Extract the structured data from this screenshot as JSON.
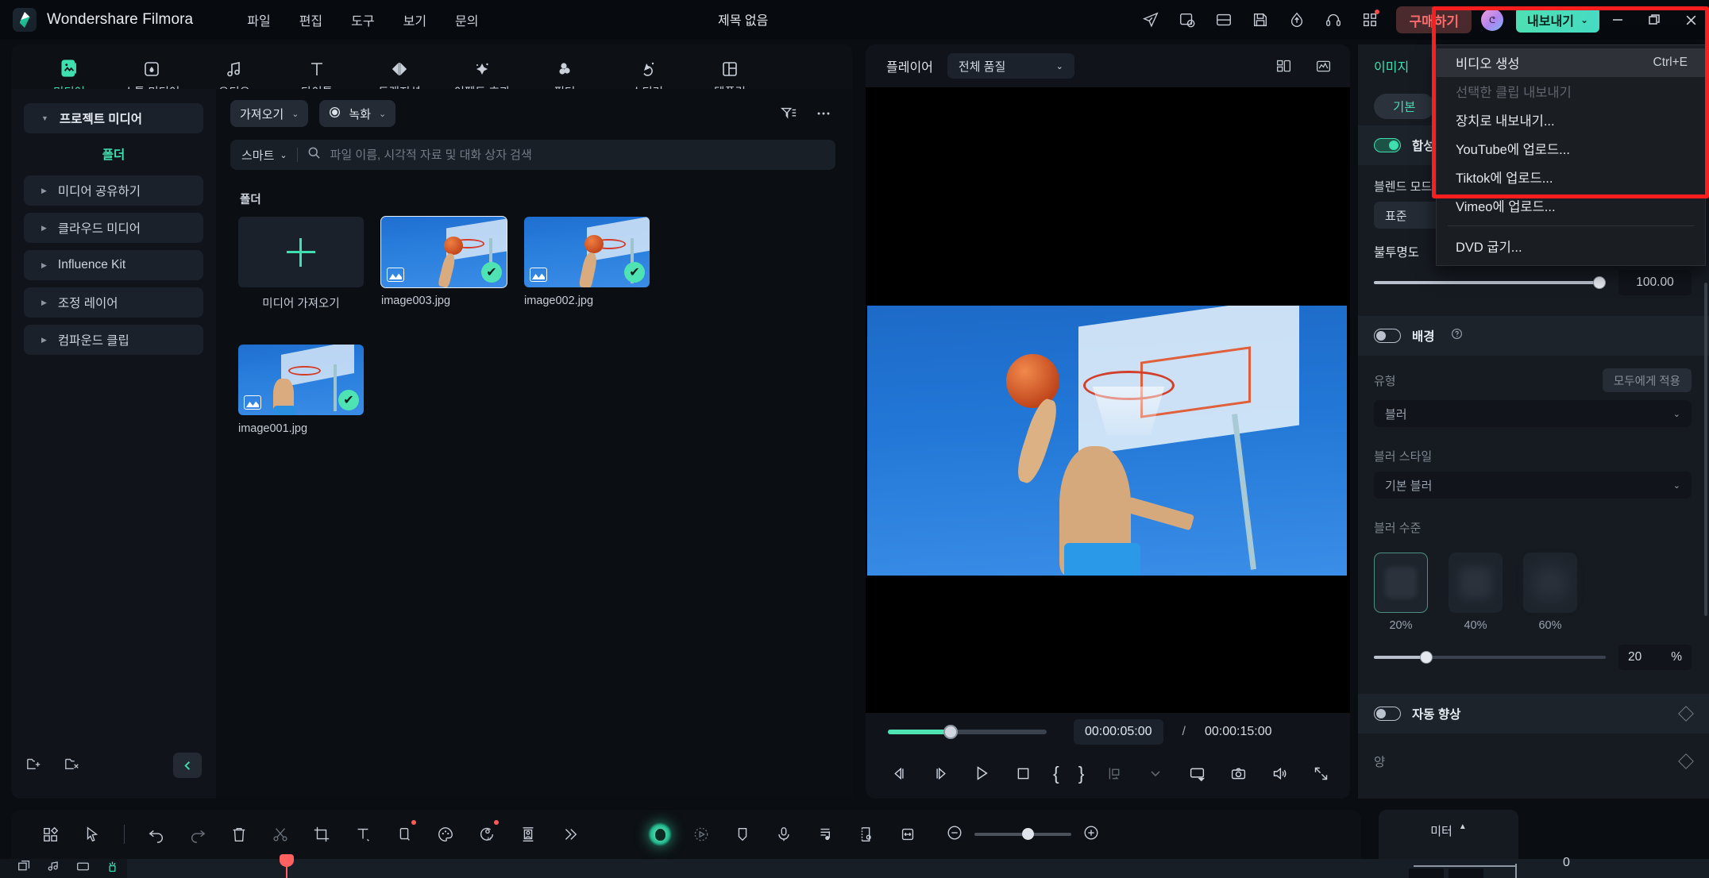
{
  "titlebar": {
    "brand": "Wondershare Filmora",
    "doc_title": "제목 없음",
    "menu": [
      "파일",
      "편집",
      "도구",
      "보기",
      "문의"
    ],
    "buy_label": "구매하기",
    "export_label": "내보내기",
    "icons": [
      "send-icon",
      "history-icon",
      "layout-icon",
      "save-icon",
      "cloud-upload-icon",
      "headset-icon",
      "apps-icon"
    ],
    "window": {
      "minimize": "minimize-icon",
      "maximize": "maximize-icon",
      "close": "close-icon"
    }
  },
  "export_menu": {
    "items": [
      {
        "label": "비디오 생성",
        "shortcut": "Ctrl+E",
        "highlighted": true,
        "disabled": false
      },
      {
        "label": "선택한 클립 내보내기",
        "shortcut": "",
        "highlighted": false,
        "disabled": true
      },
      {
        "label": "장치로 내보내기...",
        "shortcut": "",
        "highlighted": false,
        "disabled": false
      },
      {
        "label": "YouTube에 업로드...",
        "shortcut": "",
        "highlighted": false,
        "disabled": false
      },
      {
        "label": "Tiktok에 업로드...",
        "shortcut": "",
        "highlighted": false,
        "disabled": false
      },
      {
        "label": "Vimeo에 업로드...",
        "shortcut": "",
        "highlighted": false,
        "disabled": false
      }
    ],
    "after_separator": [
      {
        "label": "DVD 굽기...",
        "shortcut": "",
        "highlighted": false,
        "disabled": false
      }
    ]
  },
  "tabs": [
    {
      "label": "미디어",
      "icon": "media-icon",
      "active": true
    },
    {
      "label": "스톡 미디어",
      "icon": "stock-media-icon",
      "active": false
    },
    {
      "label": "오디오",
      "icon": "audio-note-icon",
      "active": false
    },
    {
      "label": "타이틀",
      "icon": "title-text-icon",
      "active": false
    },
    {
      "label": "트랜지션",
      "icon": "transition-icon",
      "active": false
    },
    {
      "label": "이펙트 효과",
      "icon": "effects-star-icon",
      "active": false
    },
    {
      "label": "필터",
      "icon": "filter-circles-icon",
      "active": false
    },
    {
      "label": "스티커",
      "icon": "sticker-icon",
      "active": false
    },
    {
      "label": "템플릿",
      "icon": "template-icon",
      "active": false
    }
  ],
  "sidebar": {
    "items": [
      {
        "label": "프로젝트 미디어",
        "expanded": true,
        "bold": true
      },
      {
        "label": "미디어 공유하기",
        "expanded": false,
        "bold": false
      },
      {
        "label": "클라우드 미디어",
        "expanded": false,
        "bold": false
      },
      {
        "label": "Influence Kit",
        "expanded": false,
        "bold": false
      },
      {
        "label": "조정 레이어",
        "expanded": false,
        "bold": false
      },
      {
        "label": "컴파운드 클립",
        "expanded": false,
        "bold": false
      }
    ],
    "folder_label": "폴더",
    "bottom_icons": [
      "new-folder-icon",
      "delete-folder-icon",
      "collapse-panel-icon"
    ]
  },
  "media_toolbar": {
    "import_label": "가져오기",
    "record_label": "녹화",
    "filter_icon": "filter-sort-icon",
    "more_icon": "more-options-icon"
  },
  "search": {
    "mode_label": "스마트",
    "placeholder": "파일 이름, 시각적 자료 및 대화 상자 검색",
    "value": ""
  },
  "media_grid": {
    "section_title": "폴더",
    "add_label": "미디어 가져오기",
    "items": [
      {
        "name": "image003.jpg",
        "selected": true,
        "checked": true
      },
      {
        "name": "image002.jpg",
        "selected": false,
        "checked": true
      },
      {
        "name": "image001.jpg",
        "selected": false,
        "checked": true
      }
    ]
  },
  "player": {
    "label": "플레이어",
    "quality": "전체 품질",
    "grid_icon": "layout-grid-icon",
    "waveform_icon": "waveform-icon",
    "current_time": "00:00:05:00",
    "separator": "/",
    "total_time": "00:00:15:00",
    "progress_percent": 33,
    "controls": [
      {
        "name": "prev-frame-button",
        "icon": "prev-frame-icon"
      },
      {
        "name": "next-frame-button",
        "icon": "next-frame-icon"
      },
      {
        "name": "play-button",
        "icon": "play-icon"
      },
      {
        "name": "stop-button",
        "icon": "stop-icon"
      },
      {
        "name": "mark-in-button",
        "icon": "brace-open-icon"
      },
      {
        "name": "mark-out-button",
        "icon": "brace-close-icon"
      },
      {
        "name": "marker-button",
        "icon": "marker-icon"
      },
      {
        "name": "marker-dropdown",
        "icon": "chevron-down-icon"
      },
      {
        "name": "screen-button",
        "icon": "monitor-icon"
      },
      {
        "name": "snapshot-button",
        "icon": "camera-icon"
      },
      {
        "name": "volume-button",
        "icon": "speaker-icon"
      },
      {
        "name": "fullscreen-button",
        "icon": "fullscreen-icon"
      }
    ]
  },
  "properties": {
    "tab": "이미지",
    "subtab": "기본",
    "composite": {
      "label": "합성",
      "enabled": true
    },
    "blend_mode": {
      "label": "블렌드 모드",
      "value": "표준"
    },
    "opacity": {
      "label": "불투명도",
      "value": "100.00",
      "percent": 100
    },
    "background": {
      "label": "배경",
      "enabled": false,
      "help_icon": "help-icon"
    },
    "type": {
      "label": "유형",
      "value": "블러",
      "apply_all": "모두에게 적용"
    },
    "blur_style": {
      "label": "블러 스타일",
      "value": "기본 블러"
    },
    "blur_level": {
      "label": "블러 수준",
      "options": [
        "20%",
        "40%",
        "60%"
      ],
      "selected_index": 0,
      "amount": "20",
      "unit": "%",
      "percent": 20
    },
    "auto_enhance": {
      "label": "자동 향상",
      "enabled": false
    },
    "next_label": "양"
  },
  "bottom_toolbar": {
    "left_icons": [
      {
        "name": "grid-view-button",
        "icon": "grid-view-icon",
        "dot": false
      },
      {
        "name": "select-tool-button",
        "icon": "cursor-icon",
        "dot": false
      },
      {
        "name": "undo-button",
        "icon": "undo-icon",
        "dot": false
      },
      {
        "name": "redo-button",
        "icon": "redo-icon",
        "dot": false
      },
      {
        "name": "delete-button",
        "icon": "trash-icon",
        "dot": false
      },
      {
        "name": "split-button",
        "icon": "scissors-icon",
        "dot": false
      },
      {
        "name": "crop-button",
        "icon": "crop-icon",
        "dot": false
      },
      {
        "name": "text-button",
        "icon": "text-icon",
        "dot": false
      },
      {
        "name": "mask-button",
        "icon": "mask-icon",
        "dot": true
      },
      {
        "name": "color-button",
        "icon": "palette-icon",
        "dot": false
      },
      {
        "name": "ai-tools-button",
        "icon": "ai-circle-icon",
        "dot": true
      },
      {
        "name": "auto-frame-button",
        "icon": "auto-frame-icon",
        "dot": false
      },
      {
        "name": "more-tools-button",
        "icon": "chevron-double-right-icon",
        "dot": false
      }
    ],
    "right_icons": [
      {
        "name": "ai-copilot-button",
        "icon": "ai-glow-icon"
      },
      {
        "name": "motion-tracking-button",
        "icon": "motion-track-icon"
      },
      {
        "name": "marker-add-button",
        "icon": "marker-tag-icon"
      },
      {
        "name": "voiceover-button",
        "icon": "mic-icon"
      },
      {
        "name": "audio-detach-button",
        "icon": "audio-list-icon"
      },
      {
        "name": "timecode-button",
        "icon": "timecode-icon"
      },
      {
        "name": "fit-timeline-button",
        "icon": "fit-width-icon"
      }
    ],
    "zoom": {
      "minus": "zoom-out-icon",
      "plus": "zoom-in-icon",
      "percent": 50
    },
    "meter_label": "미터",
    "meter_arrow": "caret-up-icon"
  },
  "timeline": {
    "ruler_start": "0",
    "left_icons": [
      "add-track-icon",
      "audio-track-icon",
      "video-track-icon",
      "effect-track-icon"
    ]
  },
  "colors": {
    "accent": "#3fe0b0",
    "highlight_box": "#fa1e1e",
    "buy_text": "#ff6b6b",
    "panel_bg": "#10141a",
    "window_bg": "#0a0d12"
  }
}
